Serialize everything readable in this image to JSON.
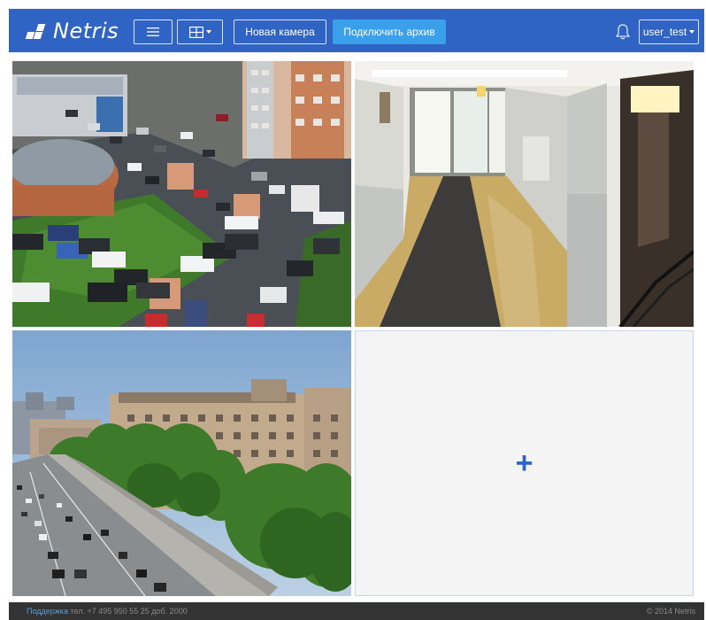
{
  "app": {
    "logo_text": "Netris"
  },
  "toolbar": {
    "new_camera_label": "Новая камера",
    "connect_archive_label": "Подключить архив",
    "user_label": "user_test"
  },
  "icons": {
    "menu": "menu-icon",
    "layout": "grid-layout-icon",
    "notifications": "bell-icon",
    "add": "plus-icon"
  },
  "cameras": [
    {
      "slot": 1,
      "scene": "parking-lot-aerial"
    },
    {
      "slot": 2,
      "scene": "building-hallway"
    },
    {
      "slot": 3,
      "scene": "city-street"
    },
    {
      "slot": 4,
      "scene": "empty"
    }
  ],
  "empty_slot": {
    "symbol": "+"
  },
  "footer": {
    "support_label": "Поддержка",
    "phone_text": "тел. +7 495 950 55 25 доб. 2000",
    "copyright": "© 2014 Netris"
  },
  "colors": {
    "header_bg": "#2f64c4",
    "primary_button": "#3ba0eb",
    "footer_bg": "#333333",
    "link": "#4fa3e8"
  }
}
